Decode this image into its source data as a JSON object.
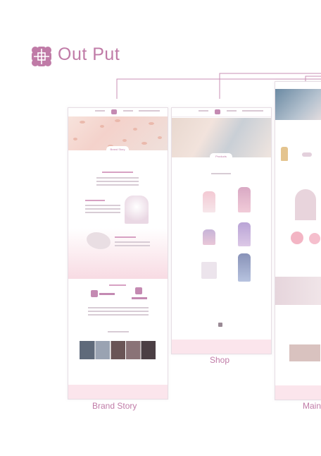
{
  "header": {
    "title": "Out Put",
    "accent_color": "#c07ba7",
    "logo_icon": "flower-lattice-logo"
  },
  "mockups": [
    {
      "caption": "Brand Story",
      "banner_tag": "Brand Story",
      "sections": [
        "Brand Story",
        "BI Design",
        "Company History"
      ]
    },
    {
      "caption": "Shop",
      "banner_tag": "Products",
      "sections": [
        "Ready to wear"
      ]
    },
    {
      "caption": "Main"
    }
  ]
}
